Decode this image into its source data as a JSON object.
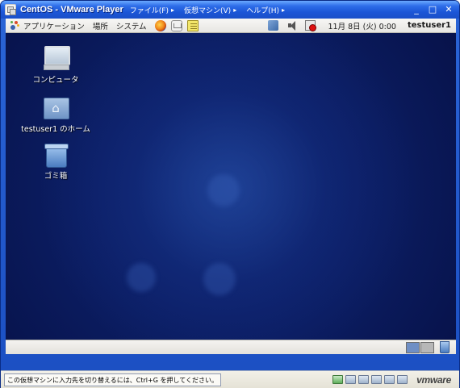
{
  "window": {
    "title": "CentOS - VMware Player",
    "menus": [
      {
        "label": "ファイル(F)"
      },
      {
        "label": "仮想マシン(V)"
      },
      {
        "label": "ヘルプ(H)"
      }
    ],
    "controls": {
      "minimize": "_",
      "maximize": "□",
      "close": "✕"
    }
  },
  "top_panel": {
    "menus": [
      "アプリケーション",
      "場所",
      "システム"
    ],
    "clock": "11月 8日 (火)  0:00",
    "username": "testuser1"
  },
  "desktop": {
    "icons": [
      {
        "label": "コンピュータ",
        "icon": "computer-icon"
      },
      {
        "label": "testuser1 のホーム",
        "icon": "home-folder-icon"
      },
      {
        "label": "ゴミ箱",
        "icon": "trash-icon"
      }
    ]
  },
  "statusbar": {
    "message": "この仮想マシンに入力先を切り替えるには、Ctrl+G を押してください。",
    "brand": "vmware"
  }
}
